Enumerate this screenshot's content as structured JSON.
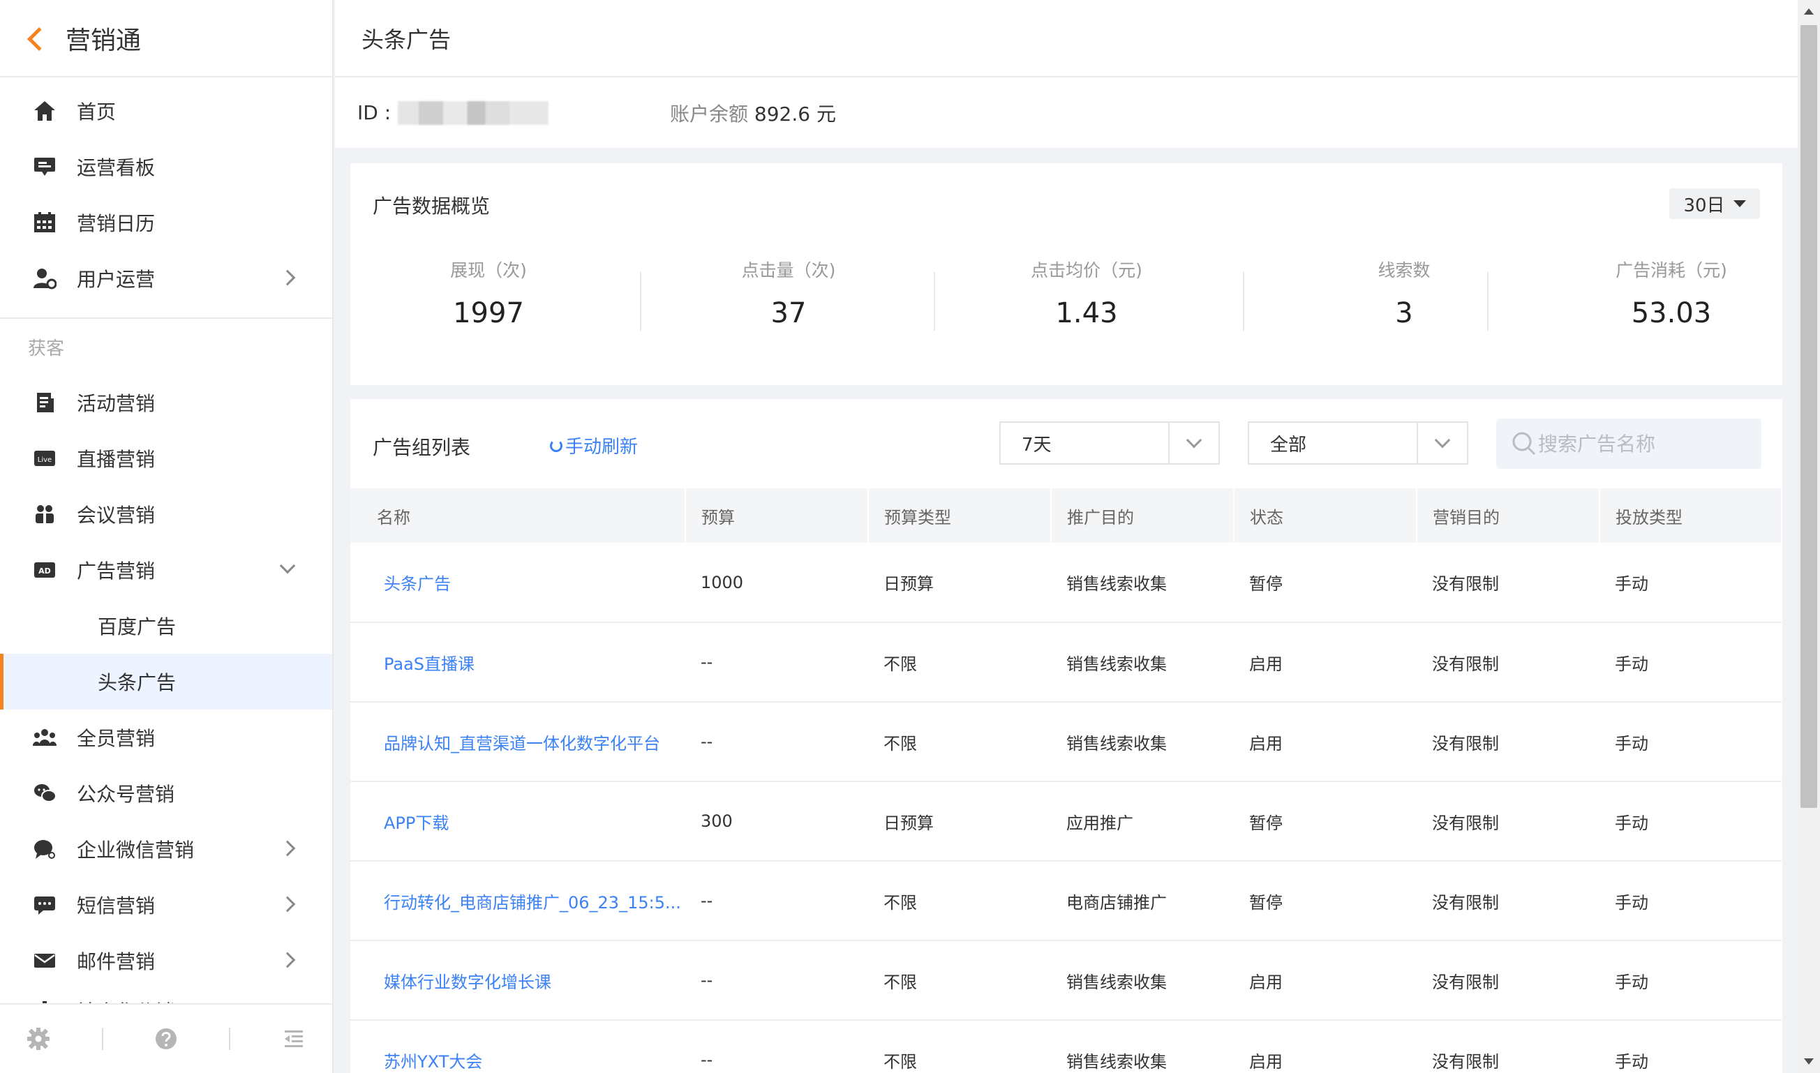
{
  "sidebar": {
    "app_title": "营销通",
    "items": [
      {
        "label": "首页",
        "icon": "home-icon"
      },
      {
        "label": "运营看板",
        "icon": "dashboard-icon"
      },
      {
        "label": "营销日历",
        "icon": "calendar-icon"
      },
      {
        "label": "用户运营",
        "icon": "user-settings-icon"
      }
    ],
    "group_label": "获客",
    "group_items": [
      {
        "label": "活动营销",
        "icon": "document-icon"
      },
      {
        "label": "直播营销",
        "icon": "live-icon",
        "badge": "Live"
      },
      {
        "label": "会议营销",
        "icon": "meeting-icon"
      },
      {
        "label": "广告营销",
        "icon": "ad-icon",
        "badge": "AD"
      },
      {
        "label": "百度广告"
      },
      {
        "label": "头条广告"
      },
      {
        "label": "全员营销",
        "icon": "team-icon"
      },
      {
        "label": "公众号营销",
        "icon": "wechat-icon"
      },
      {
        "label": "企业微信营销",
        "icon": "chat-bubble-icon"
      },
      {
        "label": "短信营销",
        "icon": "sms-icon"
      },
      {
        "label": "邮件营销",
        "icon": "mail-icon"
      }
    ],
    "cut_off_label": "社会化分销"
  },
  "header": {
    "title": "头条广告"
  },
  "account": {
    "id_label": "ID :",
    "balance_label": "账户余额",
    "balance_value": "892.6 元"
  },
  "overview": {
    "title": "广告数据概览",
    "period": "30日",
    "stats": [
      {
        "label": "展现（次)",
        "value": "1997"
      },
      {
        "label": "点击量（次)",
        "value": "37"
      },
      {
        "label": "点击均价（元)",
        "value": "1.43"
      },
      {
        "label": "线索数",
        "value": "3"
      },
      {
        "label": "广告消耗（元)",
        "value": "53.03"
      }
    ]
  },
  "list": {
    "title": "广告组列表",
    "refresh": "手动刷新",
    "filter_days": "7天",
    "filter_status": "全部",
    "search_placeholder": "搜索广告名称",
    "columns": [
      "名称",
      "预算",
      "预算类型",
      "推广目的",
      "状态",
      "营销目的",
      "投放类型"
    ],
    "rows": [
      [
        "头条广告",
        "1000",
        "日预算",
        "销售线索收集",
        "暂停",
        "没有限制",
        "手动"
      ],
      [
        "PaaS直播课",
        "--",
        "不限",
        "销售线索收集",
        "启用",
        "没有限制",
        "手动"
      ],
      [
        "品牌认知_直营渠道一体化数字化平台",
        "--",
        "不限",
        "销售线索收集",
        "启用",
        "没有限制",
        "手动"
      ],
      [
        "APP下载",
        "300",
        "日预算",
        "应用推广",
        "暂停",
        "没有限制",
        "手动"
      ],
      [
        "行动转化_电商店铺推广_06_23_15:5...",
        "--",
        "不限",
        "电商店铺推广",
        "暂停",
        "没有限制",
        "手动"
      ],
      [
        "媒体行业数字化增长课",
        "--",
        "不限",
        "销售线索收集",
        "启用",
        "没有限制",
        "手动"
      ],
      [
        "苏州YXT大会",
        "--",
        "不限",
        "销售线索收集",
        "启用",
        "没有限制",
        "手动"
      ]
    ]
  },
  "colors": {
    "accent": "#f5841f",
    "link": "#3b82f6",
    "active_bg": "#eef4ff"
  }
}
